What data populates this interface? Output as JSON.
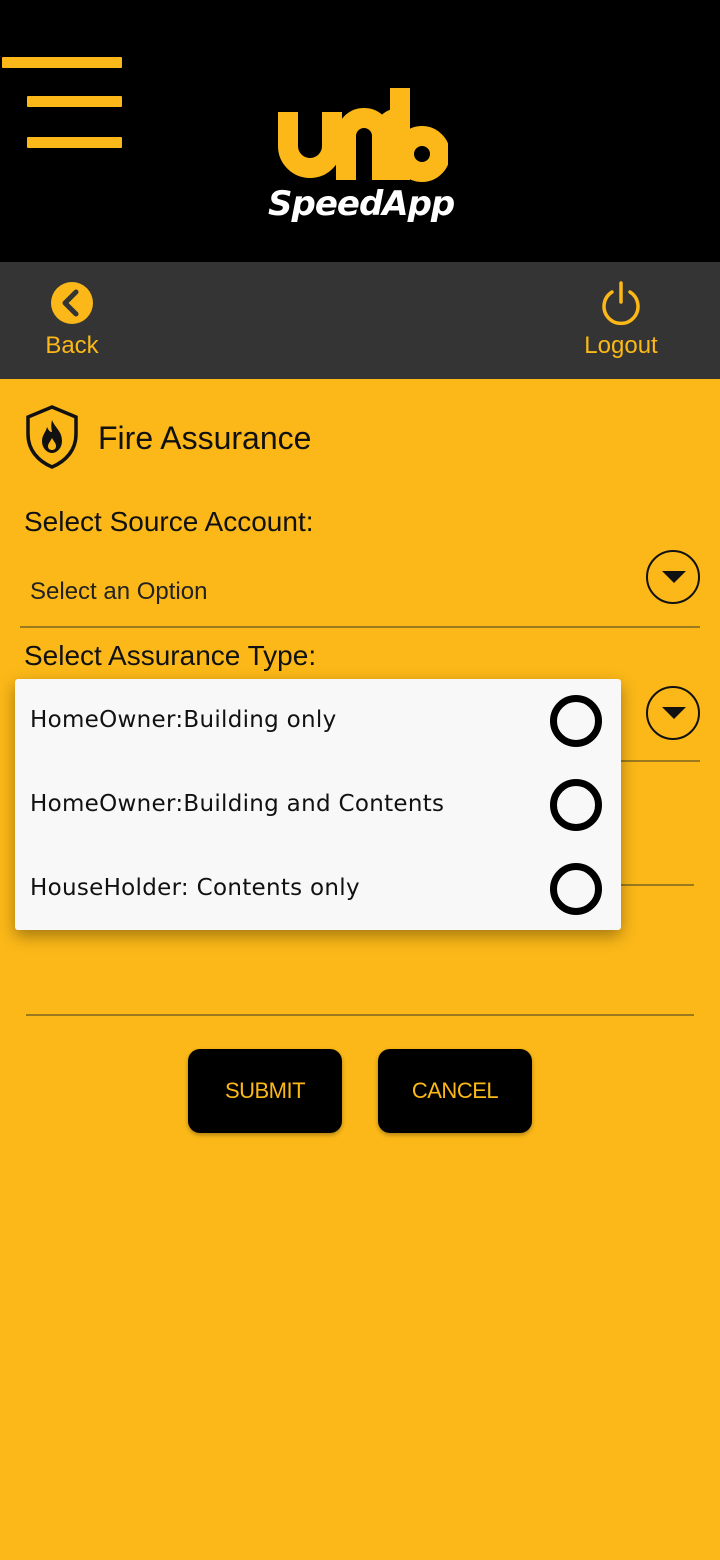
{
  "header": {
    "logo_word": "SpeedApp",
    "logo_mark_text": "umb"
  },
  "nav": {
    "back_label": "Back",
    "logout_label": "Logout"
  },
  "page": {
    "title": "Fire Assurance"
  },
  "form": {
    "source_account_label": "Select Source Account:",
    "source_account_value": "Select an Option",
    "assurance_type_label": "Select Assurance Type:"
  },
  "assurance_options": [
    {
      "label": "HomeOwner:Building only",
      "selected": false
    },
    {
      "label": "HomeOwner:Building and Contents",
      "selected": false
    },
    {
      "label": "HouseHolder: Contents only",
      "selected": false
    }
  ],
  "buttons": {
    "submit": "SUBMIT",
    "cancel": "CANCEL"
  },
  "colors": {
    "brand_yellow": "#FBB818",
    "topbar": "#000000",
    "navbar": "#343434"
  },
  "icons": [
    "menu-icon",
    "back-icon",
    "power-icon",
    "fire-shield-icon",
    "chevron-down-icon",
    "radio-icon"
  ]
}
